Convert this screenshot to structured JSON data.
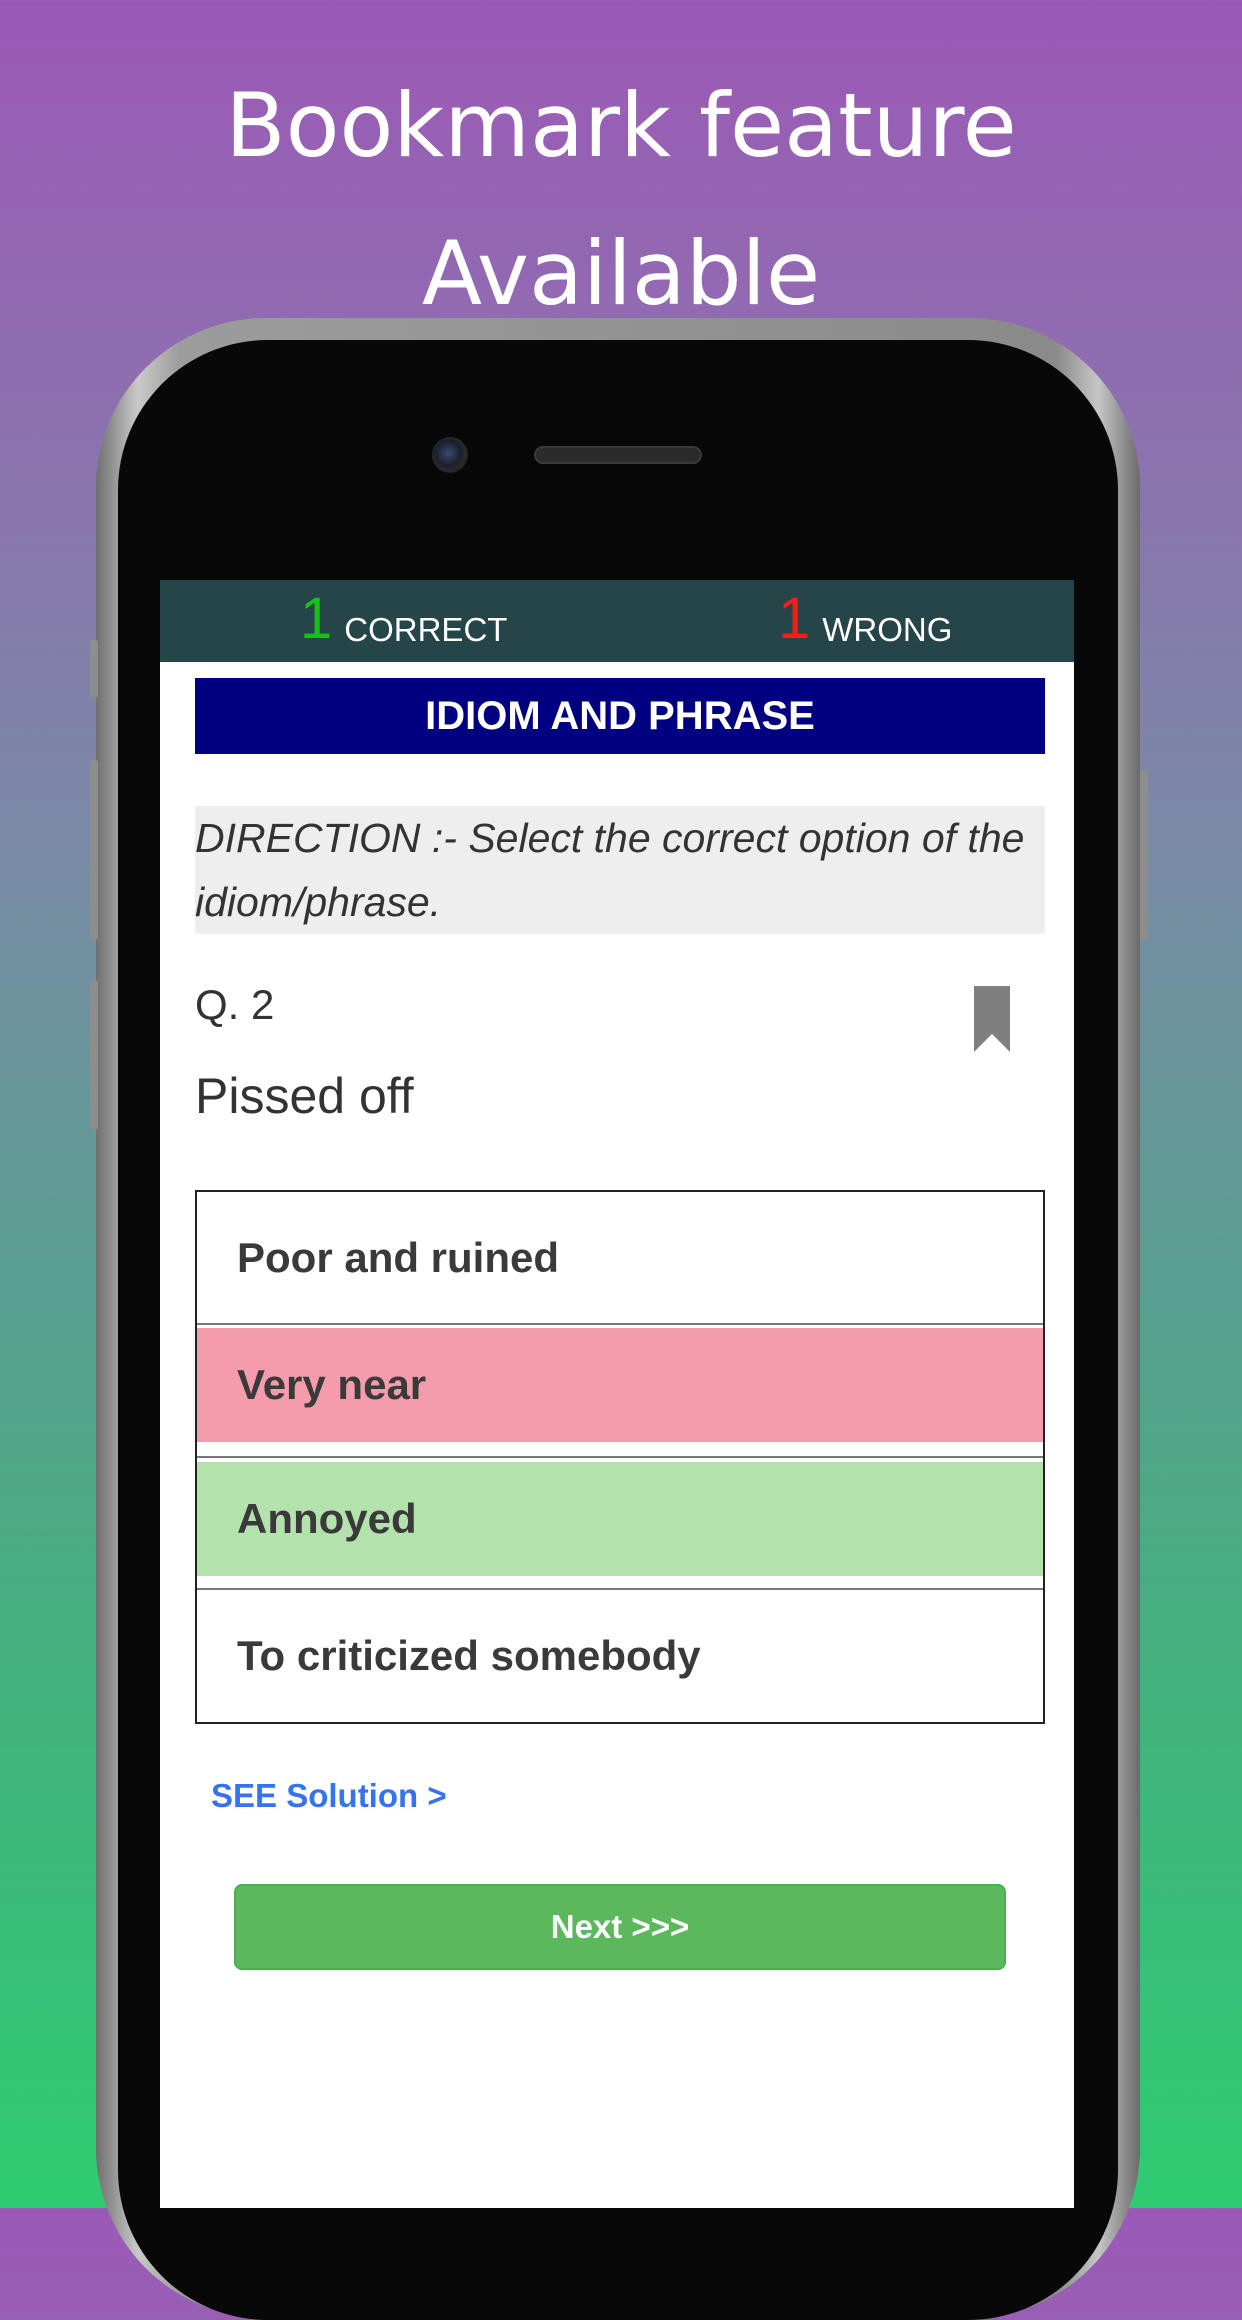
{
  "promo": {
    "line1": "Bookmark feature",
    "line2": "Available"
  },
  "scoreboard": {
    "correct_count": "1",
    "correct_label": "CORRECT",
    "wrong_count": "1",
    "wrong_label": "WRONG"
  },
  "quiz": {
    "category": "IDIOM AND PHRASE",
    "direction": "DIRECTION :- Select the correct option of the idiom/phrase.",
    "question_number": "Q. 2",
    "question": "Pissed off",
    "options": [
      {
        "label": "Poor and ruined",
        "state": "neutral"
      },
      {
        "label": "Very near",
        "state": "wrong"
      },
      {
        "label": "Annoyed",
        "state": "correct"
      },
      {
        "label": "To criticized somebody",
        "state": "neutral"
      }
    ],
    "bookmark_icon": "bookmark-icon"
  },
  "actions": {
    "see_solution": "SEE Solution >",
    "next": "Next >>>"
  },
  "colors": {
    "score_bar": "#264548",
    "correct_count": "#19c019",
    "wrong_count": "#ff1a1a",
    "category_bg": "#000080",
    "wrong_option_bg": "#f49cac",
    "correct_option_bg": "#b4e2ad",
    "link": "#3573f2",
    "next_button": "#5cb85c"
  }
}
